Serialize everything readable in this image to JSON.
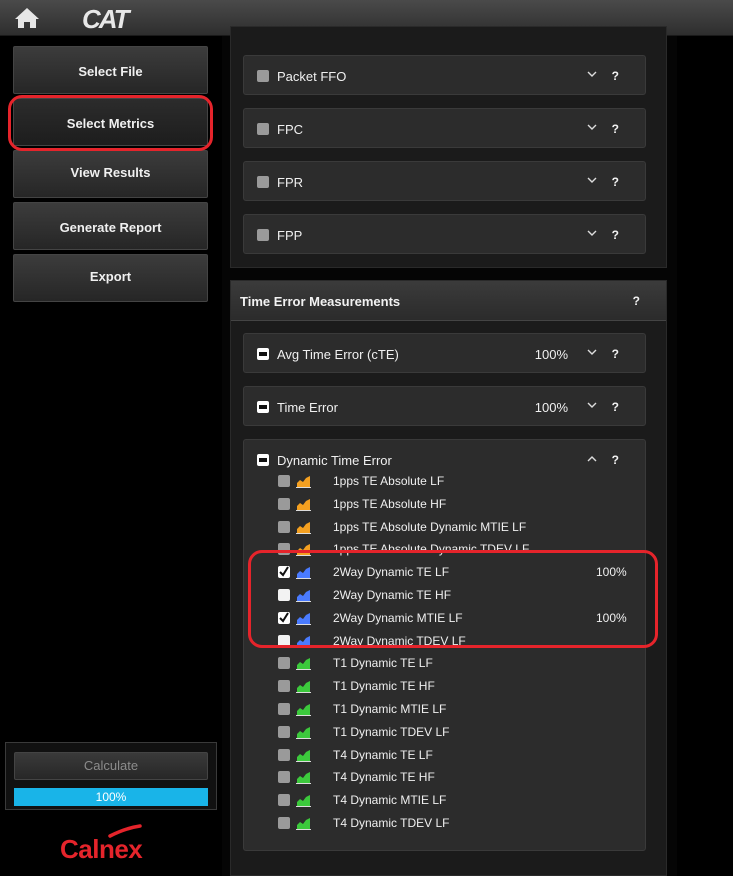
{
  "app": {
    "logo_text": "CAT",
    "brand_text": "Calnex",
    "colors": {
      "accent_red": "#e5242b",
      "progress_blue": "#19b4e8",
      "te_orange": "#f4a020",
      "twoway_blue": "#4a7bff",
      "t_green": "#3cc93c"
    }
  },
  "sidebar": {
    "items": [
      {
        "label": "Select File"
      },
      {
        "label": "Select Metrics"
      },
      {
        "label": "View Results"
      },
      {
        "label": "Generate Report"
      },
      {
        "label": "Export"
      }
    ],
    "active_item": "Select Metrics",
    "calculate_label": "Calculate",
    "progress": {
      "fraction": 1.0,
      "text": "100%"
    }
  },
  "packet_group": {
    "cards": [
      {
        "label": "Packet FFO"
      },
      {
        "label": "FPC"
      },
      {
        "label": "FPR"
      },
      {
        "label": "FPP"
      }
    ]
  },
  "time_error_group": {
    "title": "Time Error Measurements",
    "help": "?",
    "avg_time_error": {
      "label": "Avg Time Error (cTE)",
      "pct": "100%"
    },
    "time_error": {
      "label": "Time Error",
      "pct": "100%"
    },
    "dynamic_time_error": {
      "label": "Dynamic Time Error",
      "metrics": [
        {
          "label": "1pps TE Absolute LF",
          "checked": false,
          "icon": "orange-area-chart-icon",
          "pct": ""
        },
        {
          "label": "1pps TE Absolute HF",
          "checked": false,
          "icon": "orange-area-chart-icon",
          "pct": ""
        },
        {
          "label": "1pps TE Absolute Dynamic MTIE LF",
          "checked": false,
          "icon": "orange-area-chart-icon",
          "pct": ""
        },
        {
          "label": "1pps TE Absolute Dynamic TDEV LF",
          "checked": false,
          "icon": "orange-area-chart-icon",
          "pct": ""
        },
        {
          "label": "2Way Dynamic TE LF",
          "checked": true,
          "icon": "blue-area-chart-icon",
          "pct": "100%"
        },
        {
          "label": "2Way Dynamic TE HF",
          "checked": false,
          "icon": "blue-area-chart-icon",
          "pct": ""
        },
        {
          "label": "2Way Dynamic MTIE LF",
          "checked": true,
          "icon": "blue-area-chart-icon",
          "pct": "100%"
        },
        {
          "label": "2Way Dynamic TDEV LF",
          "checked": false,
          "icon": "blue-area-chart-icon",
          "pct": ""
        },
        {
          "label": "T1 Dynamic TE LF",
          "checked": false,
          "icon": "green-area-chart-icon",
          "pct": ""
        },
        {
          "label": "T1 Dynamic TE HF",
          "checked": false,
          "icon": "green-area-chart-icon",
          "pct": ""
        },
        {
          "label": "T1 Dynamic MTIE LF",
          "checked": false,
          "icon": "green-area-chart-icon",
          "pct": ""
        },
        {
          "label": "T1 Dynamic TDEV LF",
          "checked": false,
          "icon": "green-area-chart-icon",
          "pct": ""
        },
        {
          "label": "T4 Dynamic TE LF",
          "checked": false,
          "icon": "green-area-chart-icon",
          "pct": ""
        },
        {
          "label": "T4 Dynamic TE HF",
          "checked": false,
          "icon": "green-area-chart-icon",
          "pct": ""
        },
        {
          "label": "T4 Dynamic MTIE LF",
          "checked": false,
          "icon": "green-area-chart-icon",
          "pct": ""
        },
        {
          "label": "T4 Dynamic TDEV LF",
          "checked": false,
          "icon": "green-area-chart-icon",
          "pct": ""
        }
      ]
    }
  },
  "help_glyph": "?"
}
